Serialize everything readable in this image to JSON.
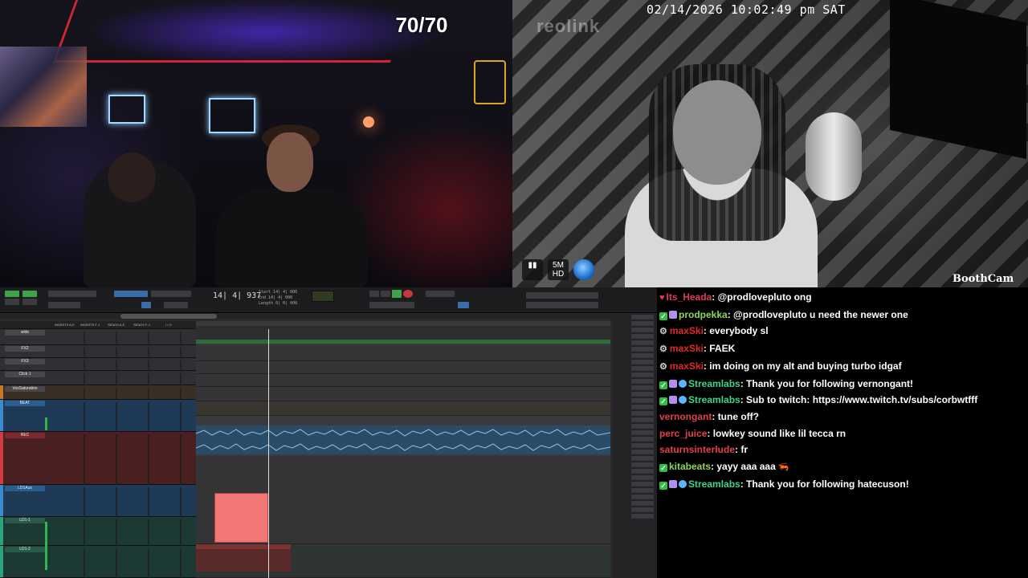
{
  "stream": {
    "counter": "70/70",
    "datetime": "02/14/2026 10:02:49 pm SAT",
    "camera_brand": "reolink",
    "camera_label": "BoothCam",
    "camera_badges": [
      "5M",
      "HD"
    ]
  },
  "daw": {
    "main_counter": "14| 4| 937",
    "accent_color": "#2f6b3a",
    "tracks": [
      {
        "name": "wlde"
      },
      {
        "name": "FX2"
      },
      {
        "name": "FX3"
      },
      {
        "name": "Click 1"
      },
      {
        "name": "VoxSaturation"
      },
      {
        "name": "BEAT"
      },
      {
        "name": "REC"
      },
      {
        "name": "LD1Aux"
      },
      {
        "name": "LD1-1"
      },
      {
        "name": "LD1-2"
      }
    ],
    "column_headers": [
      "INSERTS A-E",
      "INSERTS F-J",
      "SENDS A-E",
      "SENDS F-J",
      "I / O"
    ]
  },
  "chat": {
    "messages": [
      {
        "badges": [
          "heart"
        ],
        "user": "Its_Heada",
        "color": "#e03c55",
        "text": "@prodlovepluto ong"
      },
      {
        "badges": [
          "check",
          "gift"
        ],
        "user": "prodpekka",
        "color": "#8fd35a",
        "text": "@prodlovepluto u need the newer one"
      },
      {
        "badges": [
          "robot"
        ],
        "user": "maxSki",
        "color": "#e02828",
        "text": "everybody sl"
      },
      {
        "badges": [
          "robot"
        ],
        "user": "maxSki",
        "color": "#e02828",
        "text": "FAEK"
      },
      {
        "badges": [
          "robot"
        ],
        "user": "maxSki",
        "color": "#e02828",
        "text": "im doing on my alt and buying turbo idgaf"
      },
      {
        "badges": [
          "check",
          "gift",
          "prime"
        ],
        "user": "Streamlabs",
        "color": "#3fd38a",
        "text": "Thank you for following vernongant!"
      },
      {
        "badges": [
          "check",
          "gift",
          "prime"
        ],
        "user": "Streamlabs",
        "color": "#3fd38a",
        "text": "Sub to twitch: https://www.twitch.tv/subs/corbwtfff"
      },
      {
        "badges": [],
        "user": "vernongant",
        "color": "#e0404a",
        "text": "tune off?"
      },
      {
        "badges": [],
        "user": "perc_juice",
        "color": "#e0404a",
        "text": "lowkey sound like lil tecca rn"
      },
      {
        "badges": [],
        "user": "saturnsinterlude",
        "color": "#e0404a",
        "text": "fr"
      },
      {
        "badges": [
          "check"
        ],
        "user": "kitabeats",
        "color": "#8fd35a",
        "text": "yayy aaa aaa",
        "emote": "shrimp"
      },
      {
        "badges": [
          "check",
          "gift",
          "prime"
        ],
        "user": "Streamlabs",
        "color": "#3fd38a",
        "text": "Thank you for following hatecuson!"
      }
    ]
  }
}
